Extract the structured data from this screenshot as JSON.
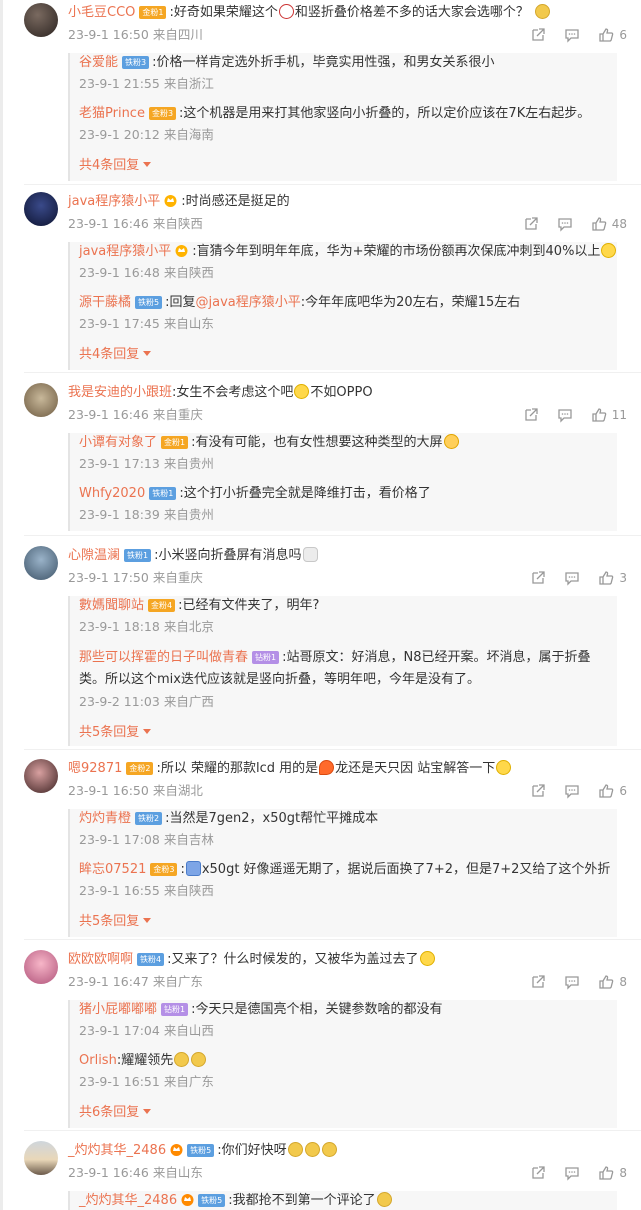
{
  "colors": {
    "accent": "#eb7350",
    "meta": "#999999",
    "reply_bg": "#f7f7f7"
  },
  "comments": [
    {
      "user": "小毛豆CCO",
      "badge": "金粉1",
      "badge_type": "gold",
      "text_a": ":好奇如果荣耀这个",
      "text_b": "和竖折叠价格差不多的话大家会选哪个？",
      "time": "23-9-1 16:50",
      "location": "来自四川",
      "likes": "6",
      "replies": [
        {
          "user": "谷爱能",
          "badge": "铁粉3",
          "badge_type": "iron",
          "text": ":价格一样肯定选外折手机，毕竟实用性强，和男女关系很小",
          "time": "23-9-1 21:55",
          "location": "来自浙江"
        },
        {
          "user": "老猫Prince",
          "badge": "金粉3",
          "badge_type": "gold",
          "text": ":这个机器是用来打其他家竖向小折叠的，所以定价应该在7K左右起步。",
          "time": "23-9-1 20:12",
          "location": "来自海南"
        }
      ],
      "more": "共4条回复"
    },
    {
      "user": "java程序猿小平",
      "text": ":时尚感还是挺足的",
      "time": "23-9-1 16:46",
      "location": "来自陕西",
      "likes": "48",
      "replies": [
        {
          "user": "java程序猿小平",
          "text": ":盲猜今年到明年年底，华为+荣耀的市场份额再次保底冲刺到40%以上",
          "time": "23-9-1 16:48",
          "location": "来自陕西"
        },
        {
          "user": "源干藤橘",
          "badge": "铁粉5",
          "badge_type": "iron",
          "text_pre": ":回复",
          "mention": "@java程序猿小平",
          "text": ":今年年底吧华为20左右，荣耀15左右",
          "time": "23-9-1 17:45",
          "location": "来自山东"
        }
      ],
      "more": "共4条回复"
    },
    {
      "user": "我是安迪的小跟班",
      "text_a": ":女生不会考虑这个吧",
      "text_b": "不如OPPO",
      "time": "23-9-1 16:46",
      "location": "来自重庆",
      "likes": "11",
      "replies": [
        {
          "user": "小谭有对象了",
          "badge": "金粉1",
          "badge_type": "gold",
          "text": ":有没有可能，也有女性想要这种类型的大屏",
          "time": "23-9-1 17:13",
          "location": "来自贵州"
        },
        {
          "user": "Whfy2020",
          "badge": "铁粉1",
          "badge_type": "iron",
          "text": ":这个打小折叠完全就是降维打击，看价格了",
          "time": "23-9-1 18:39",
          "location": "来自贵州"
        }
      ]
    },
    {
      "user": "心隙温澜",
      "badge": "铁粉1",
      "badge_type": "iron",
      "text": ":小米竖向折叠屏有消息吗",
      "time": "23-9-1 17:50",
      "location": "来自重庆",
      "likes": "3",
      "replies": [
        {
          "user": "數媽聞聊站",
          "badge": "金粉4",
          "badge_type": "gold",
          "text": ":已经有文件夹了，明年?",
          "time": "23-9-1 18:18",
          "location": "来自北京"
        },
        {
          "user": "那些可以挥霍的日子叫做青春",
          "badge": "钻粉1",
          "badge_type": "diamond",
          "text": ":站哥原文：好消息，N8已经开案。坏消息，属于折叠类。所以这个mix迭代应该就是竖向折叠，等明年吧，今年是没有了。",
          "time": "23-9-2 11:03",
          "location": "来自广西"
        }
      ],
      "more": "共5条回复"
    },
    {
      "user": "嗯92871",
      "badge": "金粉2",
      "badge_type": "gold",
      "text_a": ":所以 荣耀的那款lcd 用的是",
      "text_b": "龙还是天只因 站宝解答一下",
      "time": "23-9-1 16:50",
      "location": "来自湖北",
      "likes": "6",
      "replies": [
        {
          "user": "灼灼青橙",
          "badge": "铁粉2",
          "badge_type": "iron",
          "text": ":当然是7gen2，x50gt帮忙平摊成本",
          "time": "23-9-1 17:08",
          "location": "来自吉林"
        },
        {
          "user": "眸忘07521",
          "badge": "金粉3",
          "badge_type": "gold",
          "text": "x50gt 好像遥遥无期了，据说后面换了7+2，但是7+2又给了这个外折",
          "time": "23-9-1 16:55",
          "location": "来自陕西"
        }
      ],
      "more": "共5条回复"
    },
    {
      "user": "欧欧欧啊啊",
      "badge": "铁粉4",
      "badge_type": "iron",
      "text": ":又来了？什么时候发的，又被华为盖过去了",
      "time": "23-9-1 16:47",
      "location": "来自广东",
      "likes": "8",
      "replies": [
        {
          "user": "猪小屁嘟嘟嘟",
          "badge": "钻粉1",
          "badge_type": "diamond",
          "text": ":今天只是德国亮个相，关键参数啥的都没有",
          "time": "23-9-1 17:04",
          "location": "来自山西"
        },
        {
          "user": "Orlish",
          "text": ":耀耀领先",
          "time": "23-9-1 16:51",
          "location": "来自广东"
        }
      ],
      "more": "共6条回复"
    },
    {
      "user": "_灼灼其华_2486",
      "badge": "铁粉5",
      "badge_type": "iron",
      "text": ":你们好快呀",
      "time": "23-9-1 16:46",
      "location": "来自山东",
      "likes": "8",
      "replies": [
        {
          "user": "_灼灼其华_2486",
          "badge": "铁粉5",
          "badge_type": "iron",
          "text": ":我都抢不到第一个评论了"
        }
      ]
    }
  ]
}
